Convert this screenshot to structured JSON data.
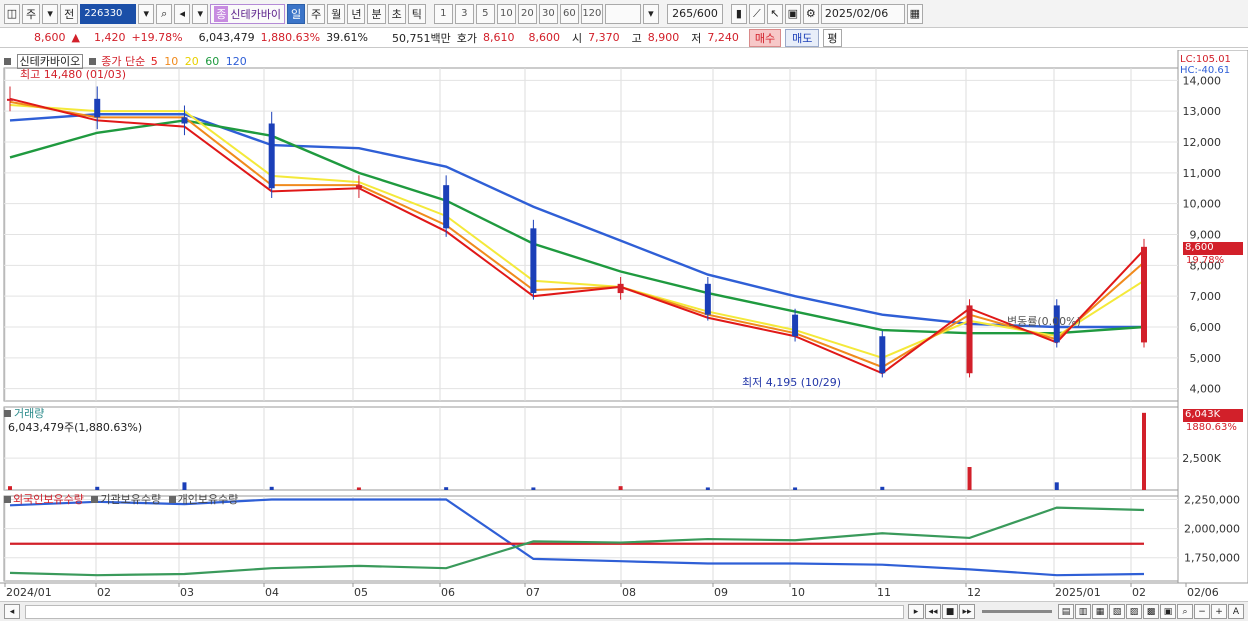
{
  "toolbar": {
    "period_main": "주",
    "prev_label": "전",
    "stock_code": "226330",
    "stock_name": "신테카바이",
    "name_badge": "종",
    "periods": [
      "일",
      "주",
      "월",
      "년",
      "분",
      "초",
      "틱"
    ],
    "active_period": "일",
    "intervals": [
      "1",
      "3",
      "5",
      "10",
      "20",
      "30",
      "60",
      "120"
    ],
    "zoom": "265/600",
    "date": "2025/02/06"
  },
  "quote": {
    "price": "8,600",
    "change_arrow": "▲",
    "change": "1,420",
    "change_pct": "+19.78%",
    "volume": "6,043,479",
    "volume_ratio": "1,880.63%",
    "turnover": "39.61%",
    "amount": "50,751백만",
    "bid_label": "호가",
    "bid1": "8,610",
    "bid2": "8,600",
    "open_label": "시",
    "open": "7,370",
    "high_label": "고",
    "high": "8,900",
    "low_label": "저",
    "low": "7,240",
    "buy_label": "매수",
    "sell_label": "매도",
    "flat_label": "평"
  },
  "price_panel": {
    "stock_name": "신테카바이오",
    "legend_title": "종가 단순",
    "ma_periods": [
      "5",
      "10",
      "20",
      "60",
      "120"
    ],
    "high_note": "최고 14,480 (01/03)",
    "low_note": "최저 4,195 (10/29)",
    "lc": "LC:105.01",
    "hc": "HC:-40.61",
    "current_price": "8,600",
    "current_pct": "19.78%",
    "watermark": "변동률(0.00%)"
  },
  "volume_panel": {
    "title": "거래량",
    "value": "6,043,479주(1,880.63%)",
    "current": "6,043K",
    "current_pct": "1880.63%",
    "tick": "2,500K"
  },
  "holdings_panel": {
    "series": [
      "외국인보유수량",
      "기관보유수량",
      "개인보유수량"
    ]
  },
  "colors": {
    "up": "#d2202a",
    "down": "#1b3fb8",
    "ma5": "#e01818",
    "ma10": "#f08a1c",
    "ma20": "#f4e93a",
    "ma60": "#1f9a3f",
    "ma120": "#2f5fd6",
    "foreign": "#2f5fd6",
    "institution": "#d2202a",
    "individual": "#3a9a5b"
  },
  "x_axis": [
    "2024/01",
    "02",
    "03",
    "04",
    "05",
    "06",
    "07",
    "08",
    "09",
    "10",
    "11",
    "12",
    "2025/01",
    "02",
    "02/06"
  ],
  "chart_data": [
    {
      "type": "candlestick",
      "title": "신테카바이오 종가 단순",
      "x": [
        "2024/01",
        "02",
        "03",
        "04",
        "05",
        "06",
        "07",
        "08",
        "09",
        "10",
        "11",
        "12",
        "2025/01",
        "02"
      ],
      "close": [
        13400,
        12800,
        12600,
        10500,
        10600,
        9200,
        7100,
        7400,
        6400,
        5700,
        4500,
        6700,
        5500,
        8600
      ],
      "ylim": [
        3600,
        14400
      ],
      "yticks": [
        14000,
        13000,
        12000,
        11000,
        10000,
        9000,
        8000,
        7000,
        6000,
        5000,
        4000
      ],
      "series": [
        {
          "name": "5",
          "values": [
            13400,
            12700,
            12500,
            10400,
            10500,
            9100,
            7000,
            7300,
            6300,
            5700,
            4500,
            6600,
            5500,
            8500
          ]
        },
        {
          "name": "10",
          "values": [
            13300,
            12800,
            12800,
            10600,
            10600,
            9300,
            7200,
            7300,
            6400,
            5800,
            4700,
            6400,
            5600,
            8100
          ]
        },
        {
          "name": "20",
          "values": [
            13200,
            13000,
            13000,
            10900,
            10700,
            9600,
            7500,
            7300,
            6500,
            5900,
            5000,
            6200,
            5700,
            7500
          ]
        },
        {
          "name": "60",
          "values": [
            11500,
            12300,
            12700,
            12200,
            11000,
            10100,
            8700,
            7800,
            7100,
            6500,
            5900,
            5800,
            5800,
            6000
          ]
        },
        {
          "name": "120",
          "values": [
            12700,
            12900,
            12900,
            11900,
            11800,
            11200,
            9900,
            8800,
            7700,
            7000,
            6400,
            6100,
            6000,
            6000
          ]
        }
      ]
    },
    {
      "type": "bar",
      "title": "거래량",
      "x": [
        "2024/01",
        "02",
        "03",
        "04",
        "05",
        "06",
        "07",
        "08",
        "09",
        "10",
        "11",
        "12",
        "2025/01",
        "02"
      ],
      "values": [
        300,
        250,
        600,
        250,
        200,
        220,
        200,
        300,
        200,
        200,
        250,
        1800,
        600,
        6043
      ],
      "ylim": [
        0,
        6500
      ],
      "yticks": [
        2500
      ]
    },
    {
      "type": "line",
      "title": "외국인보유수량 기관보유수량 개인보유수량",
      "x": [
        "2024/01",
        "02",
        "03",
        "04",
        "05",
        "06",
        "07",
        "08",
        "09",
        "10",
        "11",
        "12",
        "2025/01",
        "02"
      ],
      "series": [
        {
          "name": "외국인보유수량",
          "values": [
            2200000,
            2230000,
            2210000,
            2250000,
            2250000,
            2250000,
            1740000,
            1720000,
            1700000,
            1700000,
            1690000,
            1650000,
            1600000,
            1610000
          ]
        },
        {
          "name": "기관보유수량",
          "values": [
            1870000,
            1870000,
            1870000,
            1870000,
            1870000,
            1870000,
            1870000,
            1870000,
            1870000,
            1870000,
            1870000,
            1870000,
            1870000,
            1870000
          ]
        },
        {
          "name": "개인보유수량",
          "values": [
            1620000,
            1600000,
            1610000,
            1660000,
            1680000,
            1660000,
            1890000,
            1880000,
            1910000,
            1900000,
            1960000,
            1920000,
            2180000,
            2160000
          ]
        }
      ],
      "ylim": [
        1550000,
        2280000
      ],
      "yticks": [
        2250000,
        2000000,
        1750000
      ]
    }
  ],
  "bottom_icons": [
    "scroll-left",
    "play",
    "stop",
    "fast-forward",
    "zoom",
    "minus",
    "plus",
    "text"
  ]
}
